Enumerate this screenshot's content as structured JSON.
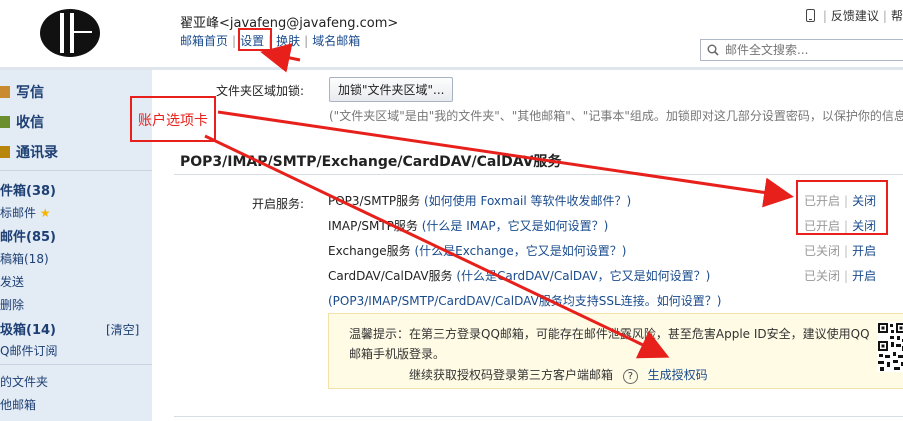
{
  "header": {
    "user_name": "翟亚峰",
    "user_email": "<javafeng@javafeng.com>",
    "nav": [
      "邮箱首页",
      "设置",
      "换肤",
      "域名邮箱"
    ],
    "feedback": "反馈建议",
    "help": "帮",
    "search_placeholder": "邮件全文搜索..."
  },
  "sidebar": {
    "actions": [
      "写信",
      "收信",
      "通讯录"
    ],
    "folders": [
      {
        "label": "件箱(38)",
        "bold": true
      },
      {
        "label": "标邮件",
        "bold": false
      },
      {
        "label": "邮件(85)",
        "bold": true
      },
      {
        "label": "稿箱(18)",
        "bold": false
      },
      {
        "label": "发送",
        "bold": false
      },
      {
        "label": "删除",
        "bold": false
      },
      {
        "label": "圾箱(14)",
        "bold": true
      },
      {
        "label": "Q邮件订阅",
        "bold": false
      },
      {
        "label": "的文件夹",
        "bold": false
      },
      {
        "label": "他邮箱",
        "bold": false
      }
    ],
    "clear_label": "[清空]"
  },
  "content": {
    "folder_lock_label": "文件夹区域加锁:",
    "folder_lock_button": "加锁\"文件夹区域\"...",
    "folder_lock_desc": "(\"文件夹区域\"是由\"我的文件夹\"、\"其他邮箱\"、\"记事本\"组成。加锁即对这几部分设置密码，以保护你的信息",
    "section_title": "POP3/IMAP/SMTP/Exchange/CardDAV/CalDAV服务",
    "open_service_label": "开启服务:",
    "services": [
      {
        "name": "POP3/SMTP服务",
        "help": "(如何使用 Foxmail 等软件收发邮件？)",
        "status": "已开启",
        "action": "关闭"
      },
      {
        "name": "IMAP/SMTP服务",
        "help": "(什么是 IMAP，它又是如何设置？)",
        "status": "已开启",
        "action": "关闭"
      },
      {
        "name": "Exchange服务",
        "help": "(什么是Exchange，它又是如何设置？)",
        "status": "已关闭",
        "action": "开启"
      },
      {
        "name": "CardDAV/CalDAV服务",
        "help": "(什么是CardDAV/CalDAV，它又是如何设置？)",
        "status": "已关闭",
        "action": "开启"
      }
    ],
    "ssl_note": "(POP3/IMAP/SMTP/CardDAV/CalDAV服务均支持SSL连接。如何设置？)",
    "tip_line1": "温馨提示：在第三方登录QQ邮箱，可能存在邮件泄露风险，甚至危害Apple ID安全，建议使用QQ",
    "tip_line2": "邮箱手机版登录。",
    "auth_text": "继续获取授权码登录第三方客户端邮箱",
    "auth_help": "?",
    "auth_link": "生成授权码"
  },
  "annotation": {
    "label": "账户选项卡",
    "color": "#e8201c"
  }
}
